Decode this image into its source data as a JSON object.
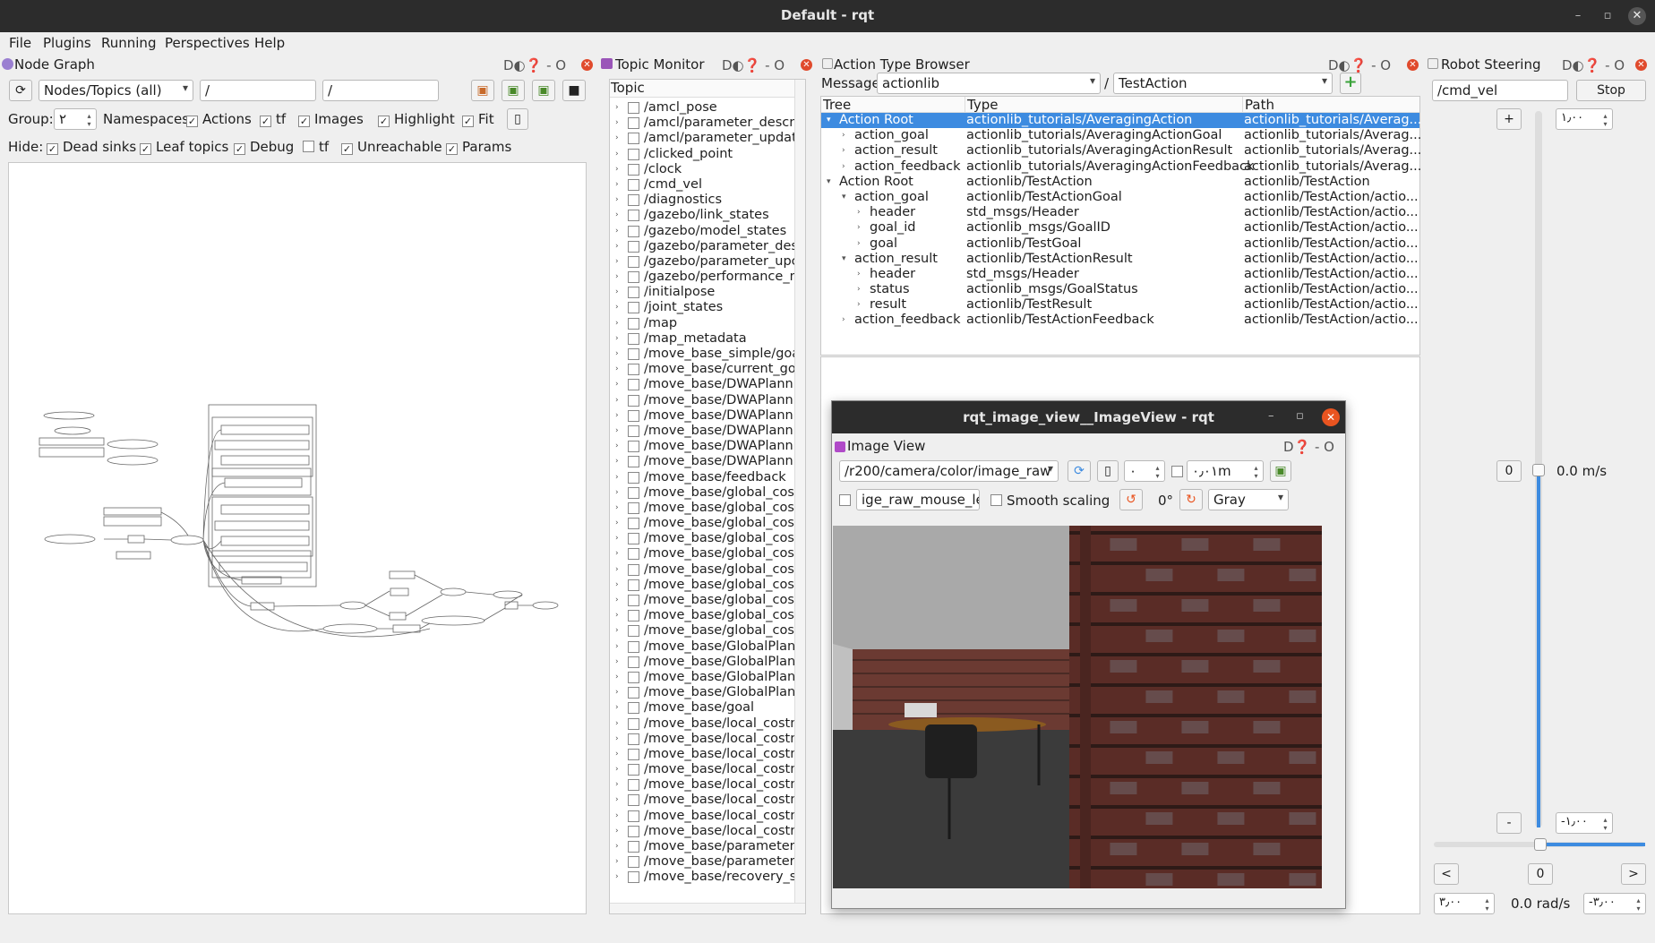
{
  "window": {
    "title": "Default - rqt"
  },
  "menu": [
    "File",
    "Plugins",
    "Running",
    "Perspectives",
    "Help"
  ],
  "node_graph": {
    "title": "Node Graph",
    "mode": "Nodes/Topics (all)",
    "ns_filter": "/",
    "topic_filter": "/",
    "group_label": "Group:",
    "group_value": "٢",
    "namespaces_label": "Namespaces",
    "actions_label": "Actions",
    "tf_label": "tf",
    "images_label": "Images",
    "highlight_label": "Highlight",
    "fit_label": "Fit",
    "hide_label": "Hide:",
    "dead_sinks_label": "Dead sinks",
    "leaf_topics_label": "Leaf topics",
    "debug_label": "Debug",
    "tf2_label": "tf",
    "unreachable_label": "Unreachable",
    "params_label": "Params"
  },
  "topic_monitor": {
    "title": "Topic Monitor",
    "header": "Topic",
    "topics": [
      "/amcl_pose",
      "/amcl/parameter_descri",
      "/amcl/parameter_updat",
      "/clicked_point",
      "/clock",
      "/cmd_vel",
      "/diagnostics",
      "/gazebo/link_states",
      "/gazebo/model_states",
      "/gazebo/parameter_des",
      "/gazebo/parameter_upc",
      "/gazebo/performance_m",
      "/initialpose",
      "/joint_states",
      "/map",
      "/map_metadata",
      "/move_base_simple/goa",
      "/move_base/current_go",
      "/move_base/DWAPlann",
      "/move_base/DWAPlann",
      "/move_base/DWAPlann",
      "/move_base/DWAPlann",
      "/move_base/DWAPlann",
      "/move_base/DWAPlann",
      "/move_base/feedback",
      "/move_base/global_cost",
      "/move_base/global_cost",
      "/move_base/global_cost",
      "/move_base/global_cost",
      "/move_base/global_cost",
      "/move_base/global_cost",
      "/move_base/global_cost",
      "/move_base/global_cost",
      "/move_base/global_cost",
      "/move_base/global_cost",
      "/move_base/GlobalPlan",
      "/move_base/GlobalPlan",
      "/move_base/GlobalPlan",
      "/move_base/GlobalPlan",
      "/move_base/goal",
      "/move_base/local_costn",
      "/move_base/local_costn",
      "/move_base/local_costn",
      "/move_base/local_costn",
      "/move_base/local_costn",
      "/move_base/local_costn",
      "/move_base/local_costn",
      "/move_base/local_costn",
      "/move_base/parameter_",
      "/move_base/parameter_",
      "/move_base/recovery_s"
    ]
  },
  "action_browser": {
    "title": "Action Type Browser",
    "message_label": "Message:",
    "package": "actionlib",
    "separator": "/",
    "action": "TestAction",
    "headers": [
      "Tree",
      "Type",
      "Path"
    ],
    "rows": [
      {
        "tree": "Action Root",
        "type": "actionlib_tutorials/AveragingAction",
        "path": "actionlib_tutorials/Averag...",
        "level": 0,
        "exp": "open",
        "selected": true
      },
      {
        "tree": "action_goal",
        "type": "actionlib_tutorials/AveragingActionGoal",
        "path": "actionlib_tutorials/Averag...",
        "level": 1,
        "exp": "closed"
      },
      {
        "tree": "action_result",
        "type": "actionlib_tutorials/AveragingActionResult",
        "path": "actionlib_tutorials/Averag...",
        "level": 1,
        "exp": "closed"
      },
      {
        "tree": "action_feedback",
        "type": "actionlib_tutorials/AveragingActionFeedback",
        "path": "actionlib_tutorials/Averag...",
        "level": 1,
        "exp": "closed"
      },
      {
        "tree": "Action Root",
        "type": "actionlib/TestAction",
        "path": "actionlib/TestAction",
        "level": 0,
        "exp": "open"
      },
      {
        "tree": "action_goal",
        "type": "actionlib/TestActionGoal",
        "path": "actionlib/TestAction/actio...",
        "level": 1,
        "exp": "open"
      },
      {
        "tree": "header",
        "type": "std_msgs/Header",
        "path": "actionlib/TestAction/actio...",
        "level": 2,
        "exp": "closed"
      },
      {
        "tree": "goal_id",
        "type": "actionlib_msgs/GoalID",
        "path": "actionlib/TestAction/actio...",
        "level": 2,
        "exp": "closed"
      },
      {
        "tree": "goal",
        "type": "actionlib/TestGoal",
        "path": "actionlib/TestAction/actio...",
        "level": 2,
        "exp": "closed"
      },
      {
        "tree": "action_result",
        "type": "actionlib/TestActionResult",
        "path": "actionlib/TestAction/actio...",
        "level": 1,
        "exp": "open"
      },
      {
        "tree": "header",
        "type": "std_msgs/Header",
        "path": "actionlib/TestAction/actio...",
        "level": 2,
        "exp": "closed"
      },
      {
        "tree": "status",
        "type": "actionlib_msgs/GoalStatus",
        "path": "actionlib/TestAction/actio...",
        "level": 2,
        "exp": "closed"
      },
      {
        "tree": "result",
        "type": "actionlib/TestResult",
        "path": "actionlib/TestAction/actio...",
        "level": 2,
        "exp": "closed"
      },
      {
        "tree": "action_feedback",
        "type": "actionlib/TestActionFeedback",
        "path": "actionlib/TestAction/actio...",
        "level": 1,
        "exp": "closed"
      }
    ]
  },
  "robot_steering": {
    "title": "Robot Steering",
    "topic": "/cmd_vel",
    "stop_label": "Stop",
    "plus_label": "+",
    "minus_label": "-",
    "max_linear": "١٫٠٠",
    "min_linear": "-١٫٠٠",
    "zero_label": "0",
    "linear_readout": "0.0 m/s",
    "left_label": "<",
    "right_label": ">",
    "max_angular": "٣٫٠٠",
    "min_angular": "-٣٫٠٠",
    "angular_readout": "0.0 rad/s"
  },
  "image_view": {
    "window_title": "rqt_image_view__ImageView - rqt",
    "title": "Image View",
    "topic": "/r200/camera/color/image_raw",
    "spin_value": "٠",
    "depth_value": "٠٫٠١m",
    "mouse_topic": "ige_raw_mouse_left",
    "smooth_label": "Smooth scaling",
    "rotation": "0°",
    "colormap": "Gray"
  }
}
